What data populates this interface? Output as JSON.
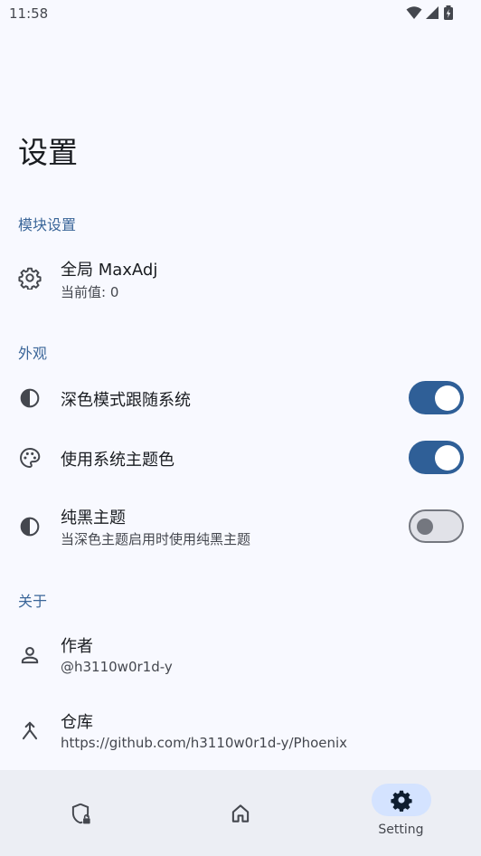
{
  "status_bar": {
    "time": "11:58",
    "icons": [
      "wifi-icon",
      "signal-icon",
      "battery-icon"
    ]
  },
  "page_title": "设置",
  "sections": {
    "module": {
      "header": "模块设置"
    },
    "appearance": {
      "header": "外观"
    },
    "about": {
      "header": "关于"
    }
  },
  "settings": {
    "global_maxadj": {
      "title": "全局 MaxAdj",
      "subtitle": "当前值: 0",
      "icon": "gear-icon"
    },
    "dark_follow_system": {
      "title": "深色模式跟随系统",
      "icon": "contrast-icon",
      "enabled": true
    },
    "system_theme_color": {
      "title": "使用系统主题色",
      "icon": "palette-icon",
      "enabled": true
    },
    "pure_black": {
      "title": "纯黑主题",
      "subtitle": "当深色主题启用时使用纯黑主题",
      "icon": "contrast-icon",
      "enabled": false
    },
    "author": {
      "title": "作者",
      "subtitle": "@h3110w0r1d-y",
      "icon": "person-icon"
    },
    "repository": {
      "title": "仓库",
      "subtitle": "https://github.com/h3110w0r1d-y/Phoenix",
      "icon": "merge-icon"
    }
  },
  "bottom_nav": {
    "items": [
      {
        "icon": "shield-lock-icon",
        "label": ""
      },
      {
        "icon": "home-icon",
        "label": ""
      },
      {
        "icon": "gear-icon",
        "label": "Setting",
        "active": true
      }
    ]
  },
  "colors": {
    "accent": "#2f5f97",
    "section_header": "#3b6699",
    "background": "#f8f9ff",
    "nav_background": "#eceef4",
    "nav_active_pill": "#d4e3ff"
  }
}
